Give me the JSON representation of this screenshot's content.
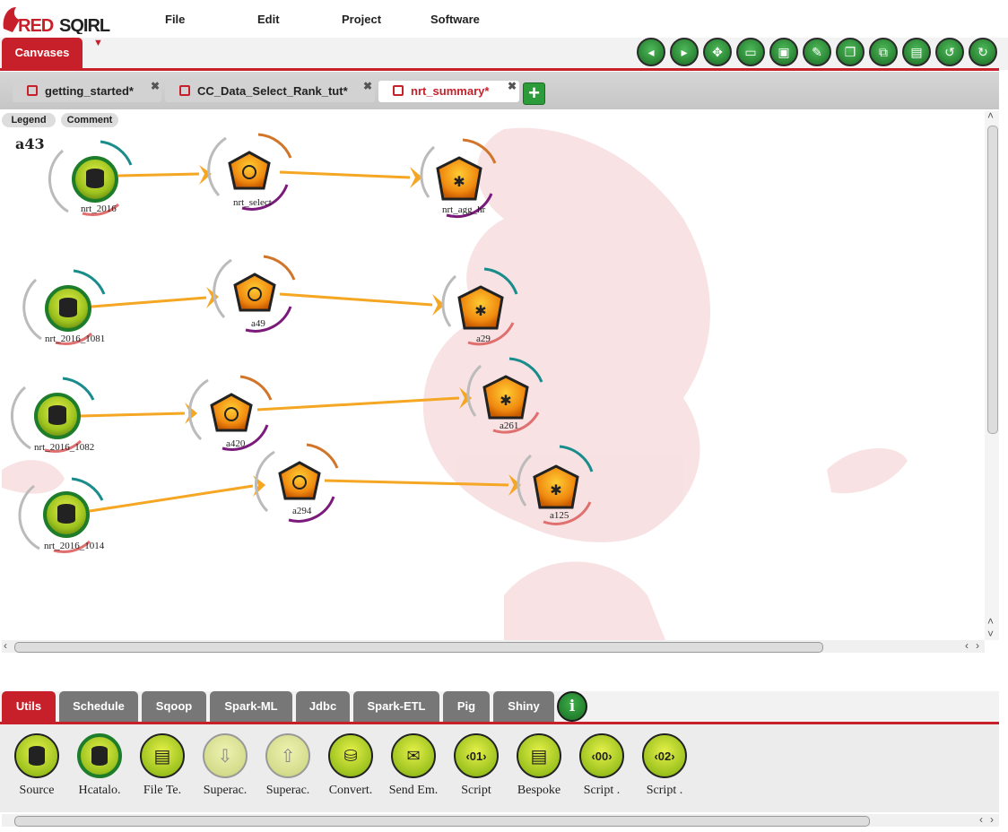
{
  "app": {
    "logo_text": "RED SQIRL"
  },
  "menu": {
    "file": "File",
    "edit": "Edit",
    "project": "Project",
    "software": "Software"
  },
  "canvases_tab": "Canvases",
  "toolbar_icons": [
    "nav-left-icon",
    "nav-right-icon",
    "move-icon",
    "open-folder-icon",
    "save-icon",
    "save-as-icon",
    "copy-icon",
    "duplicate-icon",
    "paste-icon",
    "undo-icon",
    "redo-icon"
  ],
  "file_tabs": [
    {
      "label": "getting_started*"
    },
    {
      "label": "CC_Data_Select_Rank_tut*"
    },
    {
      "label": "nrt_summary*"
    }
  ],
  "canvas": {
    "legend": "Legend",
    "comment": "Comment",
    "title": "a43",
    "nodes": {
      "n1": "nrt_2016",
      "n2": "nrt_select",
      "n3": "nrt_agg_hr",
      "n4": "nrt_2016_1081",
      "n5": "a49",
      "n6": "a29",
      "n7": "nrt_2016_1082",
      "n8": "a420",
      "n9": "a261",
      "n10": "nrt_2016_1014",
      "n11": "a294",
      "n12": "a125"
    }
  },
  "palette_tabs": [
    "Utils",
    "Schedule",
    "Sqoop",
    "Spark-ML",
    "Jdbc",
    "Spark-ETL",
    "Pig",
    "Shiny"
  ],
  "palette_items": [
    "Source",
    "Hcatalo.",
    "File Te.",
    "Superac.",
    "Superac.",
    "Convert.",
    "Send Em.",
    "Script",
    "Bespoke",
    "Script .",
    "Script ."
  ],
  "colors": {
    "brand_red": "#c8202a",
    "green": "#2e8b38",
    "orange": "#f0a020",
    "link": "#f5a623"
  }
}
